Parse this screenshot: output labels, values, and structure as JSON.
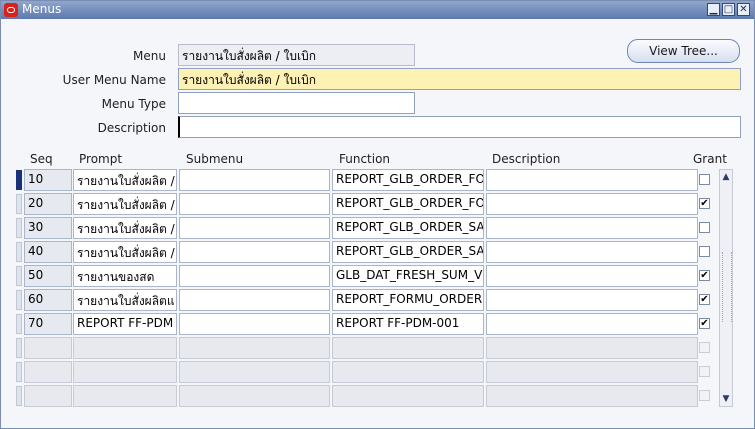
{
  "window": {
    "title": "Menus",
    "controls": [
      "minimize",
      "maximize",
      "close"
    ]
  },
  "header": {
    "menu_label": "Menu",
    "menu_value": "รายงานใบสั่งผลิต / ใบเบิก",
    "user_menu_name_label": "User Menu Name",
    "user_menu_name_value": "รายงานใบสั่งผลิต / ใบเบิก",
    "menu_type_label": "Menu Type",
    "menu_type_value": "",
    "description_label": "Description",
    "description_value": "",
    "view_tree_label": "View Tree..."
  },
  "grid": {
    "columns": [
      "Seq",
      "Prompt",
      "Submenu",
      "Function",
      "Description",
      "Grant"
    ],
    "rows": [
      {
        "seq": "10",
        "prompt": "รายงานใบสั่งผลิต /",
        "submenu": "",
        "function": "REPORT_GLB_ORDER_FO",
        "description": "",
        "grant": false
      },
      {
        "seq": "20",
        "prompt": "รายงานใบสั่งผลิต /",
        "submenu": "",
        "function": "REPORT_GLB_ORDER_FO",
        "description": "",
        "grant": true
      },
      {
        "seq": "30",
        "prompt": "รายงานใบสั่งผลิต /",
        "submenu": "",
        "function": "REPORT_GLB_ORDER_SA",
        "description": "",
        "grant": false
      },
      {
        "seq": "40",
        "prompt": "รายงานใบสั่งผลิต /",
        "submenu": "",
        "function": "REPORT_GLB_ORDER_SA",
        "description": "",
        "grant": false
      },
      {
        "seq": "50",
        "prompt": "รายงานของสด",
        "submenu": "",
        "function": "GLB_DAT_FRESH_SUM_V",
        "description": "",
        "grant": true
      },
      {
        "seq": "60",
        "prompt": "รายงานใบสั่งผลิตแ",
        "submenu": "",
        "function": "REPORT_FORMU_ORDER",
        "description": "",
        "grant": true
      },
      {
        "seq": "70",
        "prompt": "REPORT FF-PDM",
        "submenu": "",
        "function": "REPORT FF-PDM-001",
        "description": "",
        "grant": true
      },
      {
        "seq": "",
        "prompt": "",
        "submenu": "",
        "function": "",
        "description": "",
        "grant": false
      },
      {
        "seq": "",
        "prompt": "",
        "submenu": "",
        "function": "",
        "description": "",
        "grant": false
      },
      {
        "seq": "",
        "prompt": "",
        "submenu": "",
        "function": "",
        "description": "",
        "grant": false
      }
    ]
  },
  "icons": {
    "app": "oracle-icon",
    "scroll_up": "scroll-up-icon",
    "scroll_down": "scroll-down-icon"
  }
}
